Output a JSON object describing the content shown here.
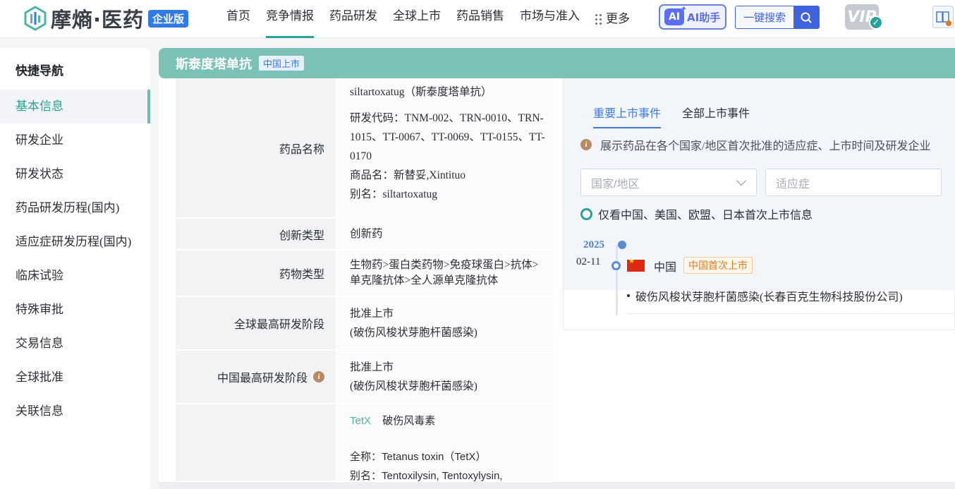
{
  "header": {
    "logo_text": "摩熵·医药",
    "logo_badge": "企业版",
    "nav": [
      "首页",
      "竞争情报",
      "药品研发",
      "全球上市",
      "药品销售",
      "市场与准入"
    ],
    "nav_more": "更多",
    "ai_logo": "AI",
    "ai_label": "AI助手",
    "search_label": "一键搜索",
    "vip_label": "VIP"
  },
  "sidebar": {
    "title": "快捷导航",
    "items": [
      "基本信息",
      "研发企业",
      "研发状态",
      "药品研发历程(国内)",
      "适应症研发历程(国内)",
      "临床试验",
      "特殊审批",
      "交易信息",
      "全球批准",
      "关联信息"
    ]
  },
  "drug": {
    "name": "斯泰度塔单抗",
    "status_badge": "中国上市"
  },
  "info": {
    "name_label": "药品名称",
    "name_line1": "siltartoxatug（斯泰度塔单抗）",
    "name_code": "研发代码：TNM-002、TRN-0010、TRN-1015、TT-0067、TT-0069、TT-0155、TT-0170",
    "name_trade": "商品名：新替妥,Xintituo",
    "name_alias": "别名：siltartoxatug",
    "innovation_label": "创新类型",
    "innovation_value": "创新药",
    "type_label": "药物类型",
    "type_value": "生物药>蛋白类药物>免疫球蛋白>抗体>单克隆抗体>全人源单克隆抗体",
    "global_label": "全球最高研发阶段",
    "global_value1": "批准上市",
    "global_value2": "(破伤风梭状芽胞杆菌感染)",
    "china_label": "中国最高研发阶段",
    "china_value1": "批准上市",
    "china_value2": "(破伤风梭状芽胞杆菌感染)",
    "target_code": "TetX",
    "target_name": "破伤风毒素",
    "target_fullname": "全称：Tetanus toxin（TetX）",
    "target_alias": "别名：Tentoxilysin, Tentoxylysin,"
  },
  "panel": {
    "tabs": [
      "重要上市事件",
      "全部上市事件"
    ],
    "hint": "展示药品在各个国家/地区首次批准的适应症、上市时间及研发企业",
    "region_placeholder": "国家/地区",
    "indication_placeholder": "适应症",
    "radio_label": "仅看中国、美国、欧盟、日本首次上市信息",
    "event": {
      "year": "2025",
      "date": "02-11",
      "country": "中国",
      "tag": "中国首次上市",
      "detail": "破伤风梭状芽胞杆菌感染(长春百克生物科技股份公司)"
    }
  }
}
